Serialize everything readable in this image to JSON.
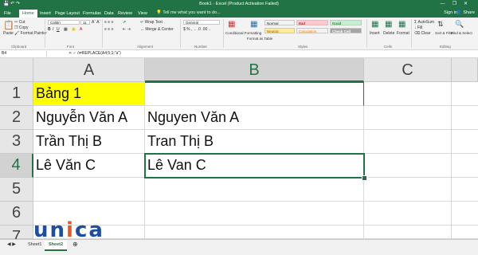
{
  "window": {
    "title": "Book1 - Excel (Product Activation Failed)",
    "qat_icons": [
      "save-icon",
      "undo-icon",
      "redo-icon"
    ],
    "controls": [
      "minimize-icon",
      "restore-icon",
      "close-icon"
    ]
  },
  "ribbon_tabs": [
    "File",
    "Home",
    "Insert",
    "Page Layout",
    "Formulas",
    "Data",
    "Review",
    "View"
  ],
  "active_tab": "Home",
  "tell_me": "Tell me what you want to do...",
  "sign_in": "Sign in",
  "share": "Share",
  "clipboard": {
    "paste": "Paste",
    "cut": "Cut",
    "copy": "Copy",
    "format_painter": "Format Painter",
    "group": "Clipboard"
  },
  "font": {
    "name": "Calibri",
    "size": "11",
    "group": "Font"
  },
  "alignment": {
    "wrap_text": "Wrap Text",
    "merge_center": "Merge & Center",
    "group": "Alignment"
  },
  "number": {
    "format": "General",
    "group": "Number"
  },
  "styles": {
    "conditional": "Conditional Formatting",
    "format_table": "Format as Table",
    "cells": [
      {
        "label": "Normal",
        "bg": "#ffffff"
      },
      {
        "label": "Bad",
        "bg": "#ffc7ce"
      },
      {
        "label": "Good",
        "bg": "#c6efce"
      },
      {
        "label": "Neutral",
        "bg": "#ffeb9c"
      },
      {
        "label": "Calculation",
        "bg": "#f2f2f2"
      },
      {
        "label": "Check Cell",
        "bg": "#a5a5a5"
      }
    ],
    "group": "Styles"
  },
  "cells_group": {
    "insert": "Insert",
    "delete": "Delete",
    "format": "Format",
    "group": "Cells"
  },
  "editing": {
    "autosum": "AutoSum",
    "fill": "Fill",
    "clear": "Clear",
    "sort_filter": "Sort & Filter",
    "find_select": "Find & Select",
    "group": "Editing"
  },
  "name_box": "B4",
  "formula": "=REPLACE(A4;5;1;\"a\")",
  "columns": [
    "A",
    "B",
    "C"
  ],
  "rows": [
    "1",
    "2",
    "3",
    "4",
    "5",
    "6",
    "7"
  ],
  "cells": {
    "A1": "Bảng 1",
    "A2": "Nguyễn Văn A",
    "B2": "Nguyen Văn A",
    "A3": "Trần Thị B",
    "B3": "Tran Thị B",
    "A4": "Lê Văn C",
    "B4": "Lê Van C"
  },
  "sheets": [
    "Sheet1",
    "Sheet2"
  ],
  "active_sheet": "Sheet2",
  "watermark": "unica",
  "colors": {
    "excel_green": "#217346",
    "highlight_yellow": "#ffff00",
    "logo_blue": "#1d4ea0",
    "logo_orange": "#e8581f"
  }
}
